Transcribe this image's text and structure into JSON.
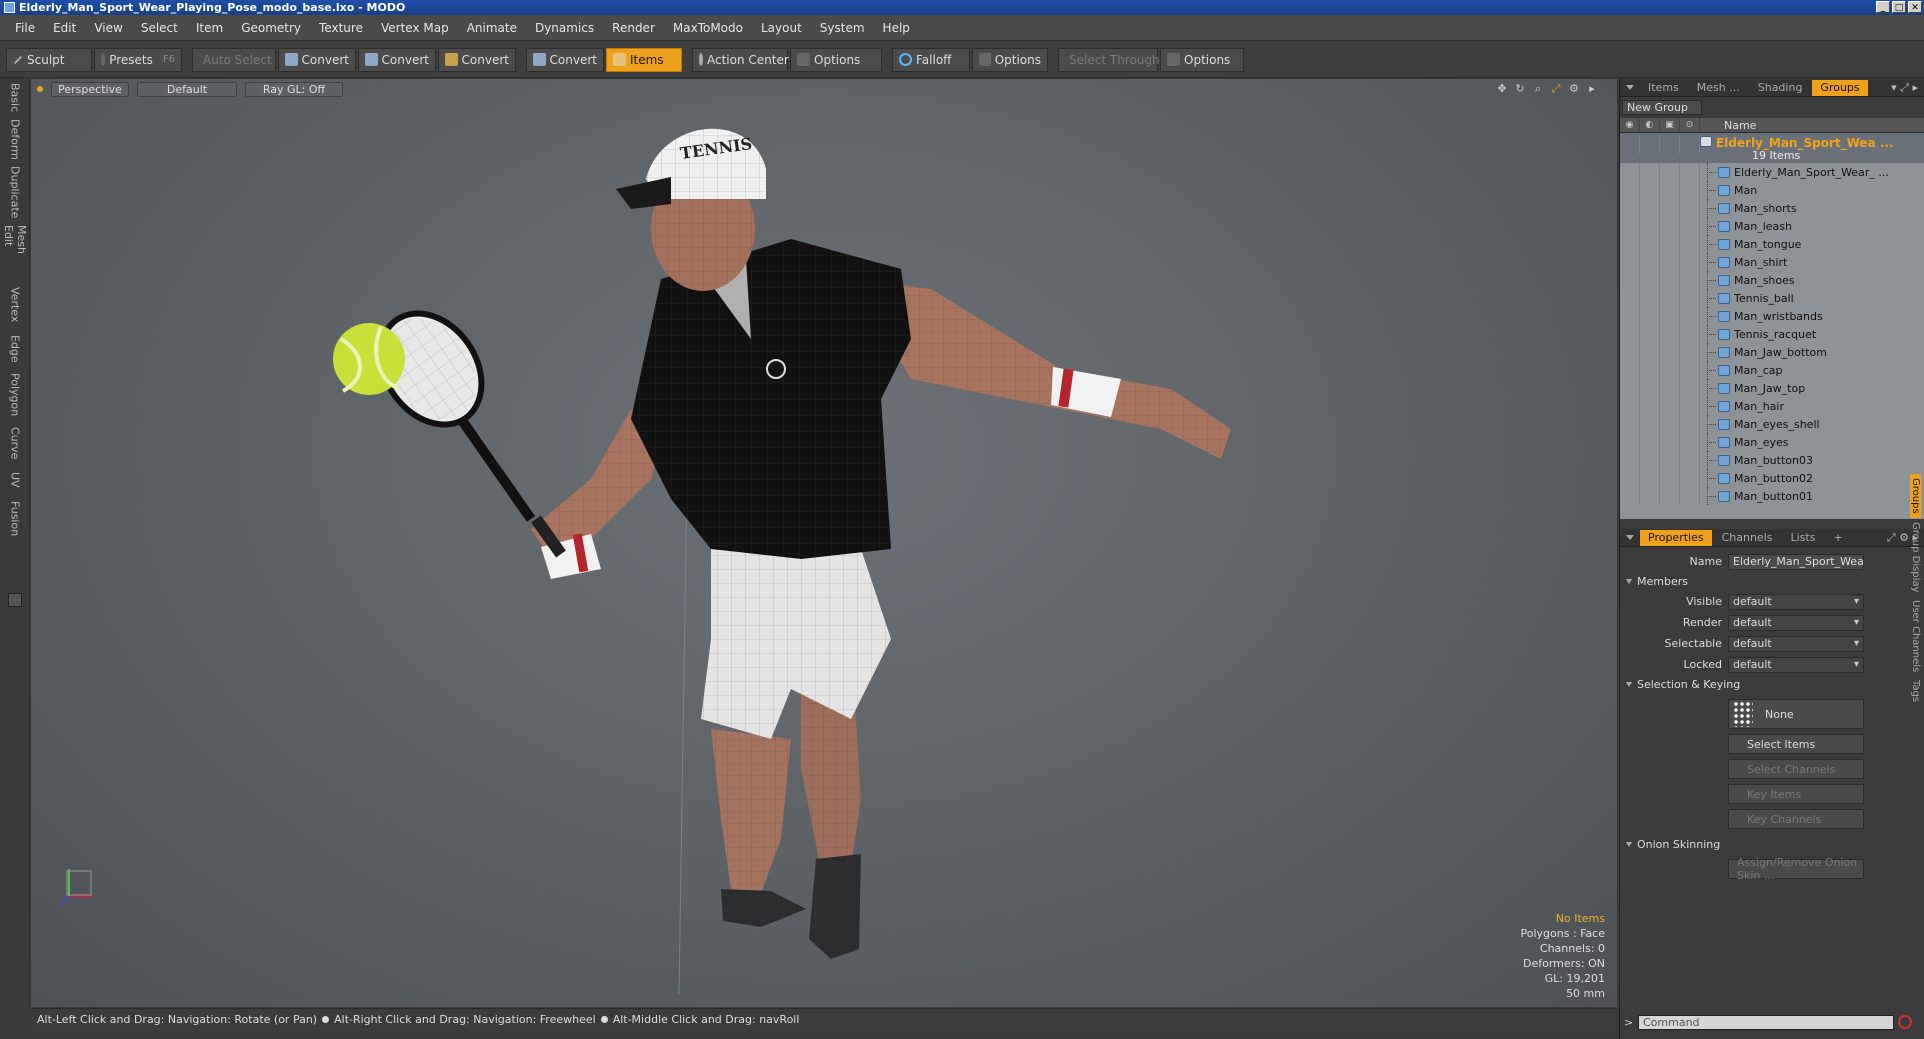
{
  "window": {
    "title": "Elderly_Man_Sport_Wear_Playing_Pose_modo_base.lxo - MODO",
    "buttons": [
      "_",
      "□",
      "✕"
    ]
  },
  "menu": [
    "File",
    "Edit",
    "View",
    "Select",
    "Item",
    "Geometry",
    "Texture",
    "Vertex Map",
    "Animate",
    "Dynamics",
    "Render",
    "MaxToModo",
    "Layout",
    "System",
    "Help"
  ],
  "toolbar": {
    "sculpt": "Sculpt",
    "presets": "Presets",
    "presets_key": "F6",
    "auto_select": "Auto Select",
    "convert1": "Convert",
    "convert2": "Convert",
    "convert3": "Convert",
    "convert4": "Convert",
    "items": "Items",
    "action_center": "Action Center",
    "options1": "Options",
    "falloff": "Falloff",
    "options2": "Options",
    "select_through": "Select Through",
    "options3": "Options"
  },
  "left_tabs": [
    "Basic",
    "Deform",
    "Duplicate",
    "Mesh Edit",
    "Vertex",
    "Edge",
    "Polygon",
    "Curve",
    "UV",
    "Fusion"
  ],
  "viewport": {
    "view": "Perspective",
    "shading": "Default",
    "raygl": "Ray GL: Off",
    "stats": {
      "selection": "No Items",
      "polygons": "Polygons : Face",
      "channels": "Channels: 0",
      "deformers": "Deformers: ON",
      "gl": "GL: 19,201",
      "focal": "50 mm"
    }
  },
  "help": {
    "left": "Alt-Left Click and Drag: Navigation: Rotate (or Pan)",
    "right": "Alt-Right Click and Drag: Navigation: Freewheel",
    "middle": "Alt-Middle Click and Drag: navRoll"
  },
  "panel_tabs": [
    "Items",
    "Mesh ...",
    "Shading",
    "Groups"
  ],
  "groups": {
    "new_group": "New Group",
    "name_header": "Name",
    "root_name": "Elderly_Man_Sport_Wea ...",
    "root_count": "19 Items",
    "items": [
      "Elderly_Man_Sport_Wear_ ...",
      "Man",
      "Man_shorts",
      "Man_leash",
      "Man_tongue",
      "Man_shirt",
      "Man_shoes",
      "Tennis_ball",
      "Man_wristbands",
      "Tennis_racquet",
      "Man_Jaw_bottom",
      "Man_cap",
      "Man_Jaw_top",
      "Man_hair",
      "Man_eyes_shell",
      "Man_eyes",
      "Man_button03",
      "Man_button02",
      "Man_button01"
    ]
  },
  "props_tabs": [
    "Properties",
    "Channels",
    "Lists",
    "+"
  ],
  "properties": {
    "name_label": "Name",
    "name_value": "Elderly_Man_Sport_Wear_Playin",
    "members": "Members",
    "visible_label": "Visible",
    "visible_value": "default",
    "render_label": "Render",
    "render_value": "default",
    "selectable_label": "Selectable",
    "selectable_value": "default",
    "locked_label": "Locked",
    "locked_value": "default",
    "selection_keying": "Selection & Keying",
    "none": "None",
    "select_items": "Select Items",
    "select_channels": "Select Channels",
    "key_items": "Key Items",
    "key_channels": "Key Channels",
    "onion": "Onion Skinning",
    "assign_onion": "Assign/Remove Onion Skin ..."
  },
  "side_tabs": [
    "Groups",
    "Group Display",
    "User Channels",
    "Tags"
  ],
  "command": {
    "prompt": ">",
    "placeholder": "Command"
  },
  "colors": {
    "accent": "#f0a11b",
    "viewport": "#5a5f63",
    "panel": "#3b3b3b"
  }
}
